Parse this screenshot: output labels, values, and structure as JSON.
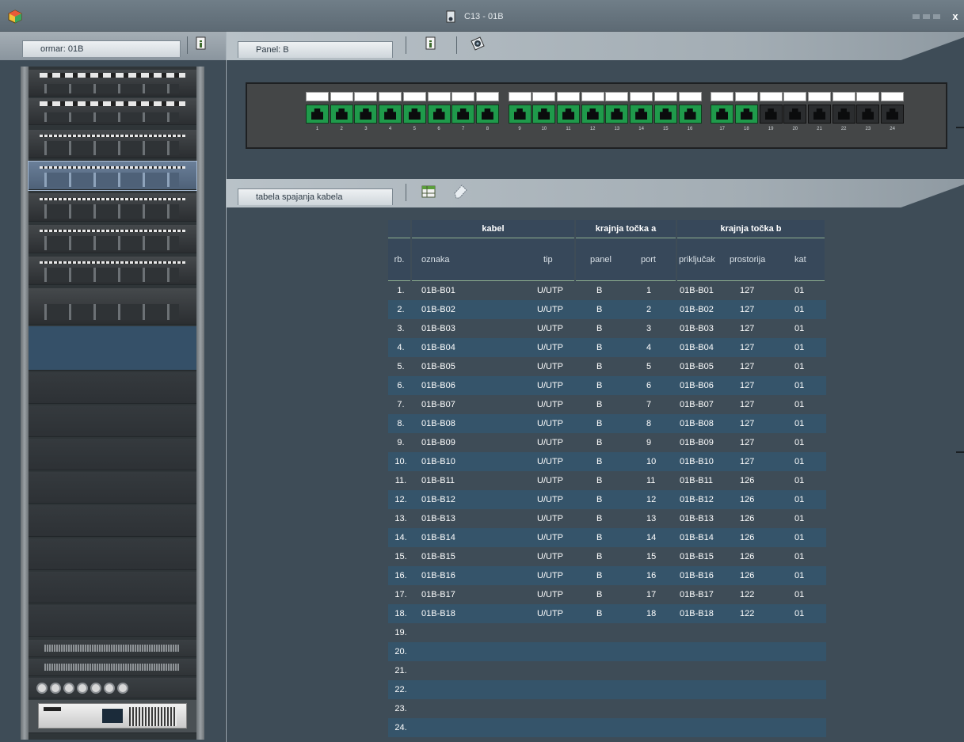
{
  "window": {
    "title": "C13 - 01B",
    "close": "x",
    "icons": [
      "app-cube-icon",
      "cabinet-icon"
    ]
  },
  "left": {
    "tab_label": "ormar: 01B",
    "info_icon": "info-page-icon"
  },
  "panel_section": {
    "tab_label": "Panel: B",
    "icons": [
      "info-page-icon",
      "camera-icon"
    ],
    "port_numbers": [
      "1",
      "2",
      "3",
      "4",
      "5",
      "6",
      "7",
      "8",
      "9",
      "10",
      "11",
      "12",
      "13",
      "14",
      "15",
      "16",
      "17",
      "18",
      "19",
      "20",
      "21",
      "22",
      "23",
      "24"
    ],
    "connected_ports": 18,
    "colors": {
      "connected": "#1f9a4b",
      "free": "#2b2d2f"
    }
  },
  "table_section": {
    "tab_label": "tabela spajanja kabela",
    "icons": [
      "table-icon",
      "eraser-icon"
    ],
    "groups": [
      "kabel",
      "krajnja točka a",
      "krajnja točka b"
    ],
    "columns": [
      "rb.",
      "oznaka",
      "tip",
      "panel",
      "port",
      "priključak",
      "prostorija",
      "kat"
    ],
    "rows": [
      [
        "1.",
        "01B-B01",
        "U/UTP",
        "B",
        "1",
        "01B-B01",
        "127",
        "01"
      ],
      [
        "2.",
        "01B-B02",
        "U/UTP",
        "B",
        "2",
        "01B-B02",
        "127",
        "01"
      ],
      [
        "3.",
        "01B-B03",
        "U/UTP",
        "B",
        "3",
        "01B-B03",
        "127",
        "01"
      ],
      [
        "4.",
        "01B-B04",
        "U/UTP",
        "B",
        "4",
        "01B-B04",
        "127",
        "01"
      ],
      [
        "5.",
        "01B-B05",
        "U/UTP",
        "B",
        "5",
        "01B-B05",
        "127",
        "01"
      ],
      [
        "6.",
        "01B-B06",
        "U/UTP",
        "B",
        "6",
        "01B-B06",
        "127",
        "01"
      ],
      [
        "7.",
        "01B-B07",
        "U/UTP",
        "B",
        "7",
        "01B-B07",
        "127",
        "01"
      ],
      [
        "8.",
        "01B-B08",
        "U/UTP",
        "B",
        "8",
        "01B-B08",
        "127",
        "01"
      ],
      [
        "9.",
        "01B-B09",
        "U/UTP",
        "B",
        "9",
        "01B-B09",
        "127",
        "01"
      ],
      [
        "10.",
        "01B-B10",
        "U/UTP",
        "B",
        "10",
        "01B-B10",
        "127",
        "01"
      ],
      [
        "11.",
        "01B-B11",
        "U/UTP",
        "B",
        "11",
        "01B-B11",
        "126",
        "01"
      ],
      [
        "12.",
        "01B-B12",
        "U/UTP",
        "B",
        "12",
        "01B-B12",
        "126",
        "01"
      ],
      [
        "13.",
        "01B-B13",
        "U/UTP",
        "B",
        "13",
        "01B-B13",
        "126",
        "01"
      ],
      [
        "14.",
        "01B-B14",
        "U/UTP",
        "B",
        "14",
        "01B-B14",
        "126",
        "01"
      ],
      [
        "15.",
        "01B-B15",
        "U/UTP",
        "B",
        "15",
        "01B-B15",
        "126",
        "01"
      ],
      [
        "16.",
        "01B-B16",
        "U/UTP",
        "B",
        "16",
        "01B-B16",
        "126",
        "01"
      ],
      [
        "17.",
        "01B-B17",
        "U/UTP",
        "B",
        "17",
        "01B-B17",
        "122",
        "01"
      ],
      [
        "18.",
        "01B-B18",
        "U/UTP",
        "B",
        "18",
        "01B-B18",
        "122",
        "01"
      ],
      [
        "19.",
        "",
        "",
        "",
        "",
        "",
        "",
        ""
      ],
      [
        "20.",
        "",
        "",
        "",
        "",
        "",
        "",
        ""
      ],
      [
        "21.",
        "",
        "",
        "",
        "",
        "",
        "",
        ""
      ],
      [
        "22.",
        "",
        "",
        "",
        "",
        "",
        "",
        ""
      ],
      [
        "23.",
        "",
        "",
        "",
        "",
        "",
        "",
        ""
      ],
      [
        "24.",
        "",
        "",
        "",
        "",
        "",
        "",
        ""
      ]
    ]
  }
}
